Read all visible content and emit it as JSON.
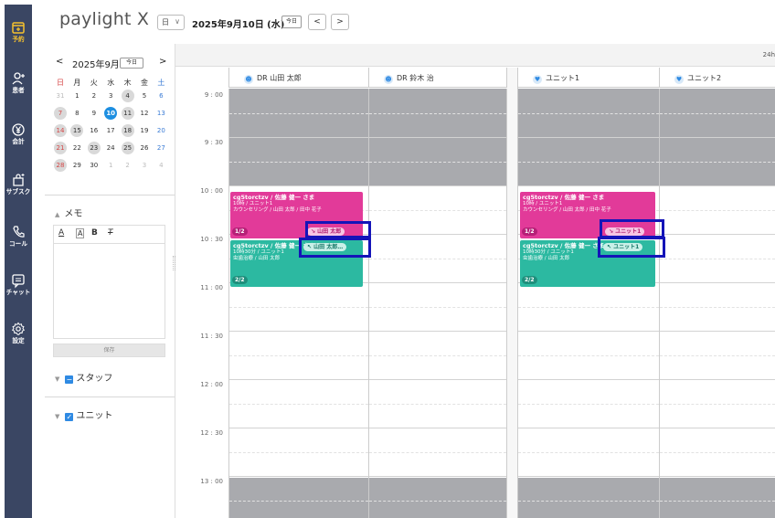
{
  "nav": {
    "items": [
      {
        "label": "予約",
        "icon": "calendar-plus-icon"
      },
      {
        "label": "患者",
        "icon": "patient-add-icon"
      },
      {
        "label": "会計",
        "icon": "yen-icon"
      },
      {
        "label": "サブスク",
        "icon": "subscription-bag-icon"
      },
      {
        "label": "コール",
        "icon": "phone-icon"
      },
      {
        "label": "チャット",
        "icon": "chat-icon"
      },
      {
        "label": "設定",
        "icon": "gear-icon"
      }
    ],
    "active_index": 0,
    "active_color": "#f5c12e",
    "background": "#3a4663"
  },
  "header": {
    "brand": "paylight X",
    "view": "日",
    "date": "2025年9月10日 (水)",
    "today": "今日",
    "prev": "<",
    "next": ">"
  },
  "mini_calendar": {
    "month_label": "2025年9月",
    "today": "今日",
    "prev": "<",
    "next": ">",
    "weekdays": [
      "日",
      "月",
      "火",
      "水",
      "木",
      "金",
      "土"
    ],
    "weeks": [
      [
        {
          "d": "31",
          "muted": true
        },
        {
          "d": "1"
        },
        {
          "d": "2"
        },
        {
          "d": "3"
        },
        {
          "d": "4",
          "booked": true
        },
        {
          "d": "5"
        },
        {
          "d": "6"
        }
      ],
      [
        {
          "d": "7",
          "booked": true
        },
        {
          "d": "8"
        },
        {
          "d": "9"
        },
        {
          "d": "10",
          "selected": true
        },
        {
          "d": "11",
          "booked": true
        },
        {
          "d": "12"
        },
        {
          "d": "13"
        }
      ],
      [
        {
          "d": "14",
          "booked": true
        },
        {
          "d": "15",
          "booked": true
        },
        {
          "d": "16"
        },
        {
          "d": "17"
        },
        {
          "d": "18",
          "booked": true
        },
        {
          "d": "19"
        },
        {
          "d": "20"
        }
      ],
      [
        {
          "d": "21",
          "booked": true
        },
        {
          "d": "22"
        },
        {
          "d": "23",
          "booked": true
        },
        {
          "d": "24"
        },
        {
          "d": "25",
          "booked": true
        },
        {
          "d": "26"
        },
        {
          "d": "27"
        }
      ],
      [
        {
          "d": "28",
          "booked": true
        },
        {
          "d": "29"
        },
        {
          "d": "30"
        },
        {
          "d": "1",
          "muted": true
        },
        {
          "d": "2",
          "muted": true
        },
        {
          "d": "3",
          "muted": true
        },
        {
          "d": "4",
          "muted": true
        }
      ]
    ]
  },
  "memo": {
    "title": "メモ",
    "tools": [
      "A",
      "A",
      "B",
      "T"
    ],
    "save": "保存"
  },
  "filters": {
    "staff": "スタッフ",
    "unit": "ユニット"
  },
  "calendar": {
    "hours_label": "24h",
    "times": [
      "9 : 00",
      "9 : 30",
      "10 : 00",
      "10 : 30",
      "11 : 00",
      "11 : 30",
      "12 : 00",
      "12 : 30",
      "13 : 00"
    ],
    "columns": [
      "DR 山田 太郎",
      "DR 鈴木 治",
      "ユニット1",
      "ユニット2"
    ],
    "events": [
      {
        "title": "cg5torctzv / 佐藤 健一 さま",
        "line1": "10時 / ユニット1",
        "line2": "カウンセリング / 山田 太郎 / 田中 花子",
        "frac": "1/2",
        "tag": "↘ 山田 太郎",
        "color": "pink"
      },
      {
        "title": "cg5torctzv / 佐藤 健一 さま",
        "line1": "10時30分 / ユニット1",
        "line2": "虫歯治療 / 山田 太郎",
        "frac": "2/2",
        "tag": "↖ 山田 太郎…",
        "color": "teal"
      },
      {
        "title": "cg5torctzv / 佐藤 健一 さま",
        "line1": "10時 / ユニット1",
        "line2": "カウンセリング / 山田 太郎 / 田中 花子",
        "frac": "1/2",
        "tag": "↘ ユニット1",
        "color": "pink"
      },
      {
        "title": "cg5torctzv / 佐藤 健一 さま",
        "line1": "10時30分 / ユニット1",
        "line2": "虫歯治療 / 山田 太郎",
        "frac": "2/2",
        "tag": "↖ ユニット1",
        "color": "teal"
      }
    ],
    "colors": {
      "pink": "#e23a99",
      "teal": "#2cb9a1",
      "closed": "#a9aaae",
      "selected_day": "#1e8fe1",
      "highlight": "#1414b8"
    }
  }
}
